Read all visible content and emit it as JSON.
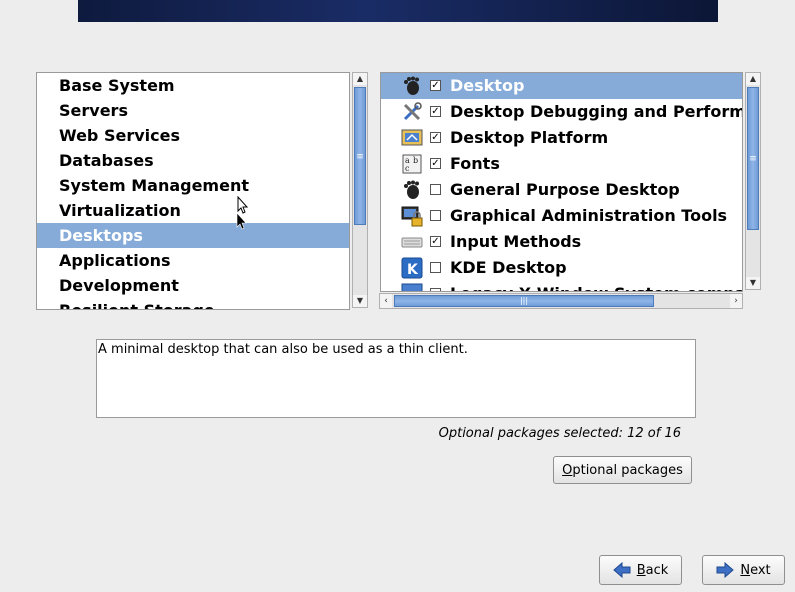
{
  "categories": {
    "items": [
      {
        "label": "Base System"
      },
      {
        "label": "Servers"
      },
      {
        "label": "Web Services"
      },
      {
        "label": "Databases"
      },
      {
        "label": "System Management"
      },
      {
        "label": "Virtualization"
      },
      {
        "label": "Desktops",
        "selected": true
      },
      {
        "label": "Applications"
      },
      {
        "label": "Development"
      },
      {
        "label": "Resilient Storage"
      }
    ]
  },
  "packages": {
    "items": [
      {
        "label": "Desktop",
        "checked": true,
        "icon": "gnome-foot-icon",
        "selected": true
      },
      {
        "label": "Desktop Debugging and Performance Tools",
        "checked": true,
        "icon": "tools-icon"
      },
      {
        "label": "Desktop Platform",
        "checked": true,
        "icon": "platform-icon"
      },
      {
        "label": "Fonts",
        "checked": true,
        "icon": "fonts-icon"
      },
      {
        "label": "General Purpose Desktop",
        "checked": false,
        "icon": "gnome-foot-icon"
      },
      {
        "label": "Graphical Administration Tools",
        "checked": false,
        "icon": "admin-lock-icon"
      },
      {
        "label": "Input Methods",
        "checked": true,
        "icon": "keyboard-icon"
      },
      {
        "label": "KDE Desktop",
        "checked": false,
        "icon": "kde-icon"
      },
      {
        "label": "Legacy X Window System compatibility",
        "checked": false,
        "icon": "x-window-icon"
      }
    ]
  },
  "description": "A minimal desktop that can also be used as a thin client.",
  "optional_count": "Optional packages selected: 12 of 16",
  "buttons": {
    "optional_packages": {
      "prefix": "",
      "mnemonic": "O",
      "rest": "ptional packages"
    },
    "back": {
      "mnemonic": "B",
      "rest": "ack"
    },
    "next": {
      "mnemonic": "N",
      "rest": "ext"
    }
  },
  "colors": {
    "selection": "#86abd9",
    "scroll_thumb": "#7aa4dd",
    "banner": "#13204a"
  }
}
